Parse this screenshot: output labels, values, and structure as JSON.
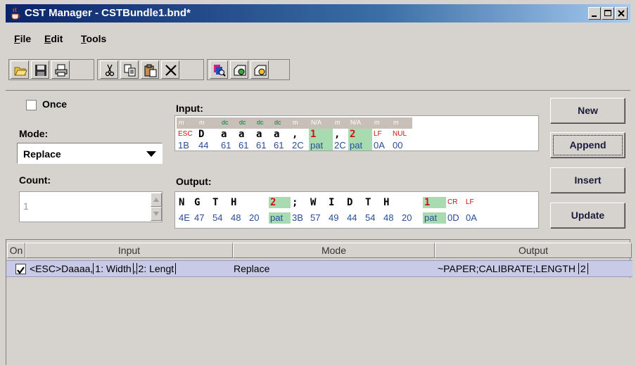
{
  "window": {
    "title": "CST Manager - CSTBundle1.bnd*"
  },
  "menu": [
    "File",
    "Edit",
    "Tools"
  ],
  "toolbar_icons": [
    "open-folder-icon",
    "save-icon",
    "print-icon",
    "cut-icon",
    "copy-icon",
    "paste-icon",
    "delete-icon",
    "search-icon",
    "tool-a-icon",
    "tool-b-icon"
  ],
  "panel": {
    "once_label": "Once",
    "once_checked": false,
    "mode_label": "Mode:",
    "mode_value": "Replace",
    "count_label": "Count:",
    "count_value": "1",
    "input_label": "Input:",
    "output_label": "Output:"
  },
  "input_hex": {
    "types": [
      "m",
      "m",
      "dc",
      "dc",
      "dc",
      "dc",
      "m",
      "N/A",
      "m",
      "N/A",
      "m",
      "m"
    ],
    "chars": [
      "ESC",
      "D",
      "a",
      "a",
      "a",
      "a",
      ",",
      "1",
      ",",
      "2",
      "LF",
      "NUL"
    ],
    "hex": [
      "1B",
      "44",
      "61",
      "61",
      "61",
      "61",
      "2C",
      "pat",
      "2C",
      "pat",
      "0A",
      "00"
    ]
  },
  "output_hex": {
    "chars": [
      "N",
      "G",
      "T",
      "H",
      "",
      "2",
      ";",
      "W",
      "I",
      "D",
      "T",
      "H",
      "",
      "1",
      "CR",
      "LF"
    ],
    "hex": [
      "4E",
      "47",
      "54",
      "48",
      "20",
      "pat",
      "3B",
      "57",
      "49",
      "44",
      "54",
      "48",
      "20",
      "pat",
      "0D",
      "0A"
    ]
  },
  "buttons": {
    "new": "New",
    "append": "Append",
    "insert": "Insert",
    "update": "Update"
  },
  "table": {
    "headers": [
      "On",
      "Input",
      "Mode",
      "Output"
    ],
    "rows": [
      {
        "on": true,
        "input_prefix": "<ESC>Daaaa,",
        "input_field1": "1: Width",
        "input_sep": ",",
        "input_field2": "2: Lengt",
        "mode": "Replace",
        "output_prefix": "~PAPER;CALIBRATE;LENGTH",
        "output_field": "2"
      }
    ]
  },
  "colors": {
    "titlebar_start": "#0a246a",
    "selection_row": "#c9c9e8",
    "pattern_cell": "#a8dcb0",
    "hex_text": "#284c9a",
    "control_text": "#d01010"
  }
}
